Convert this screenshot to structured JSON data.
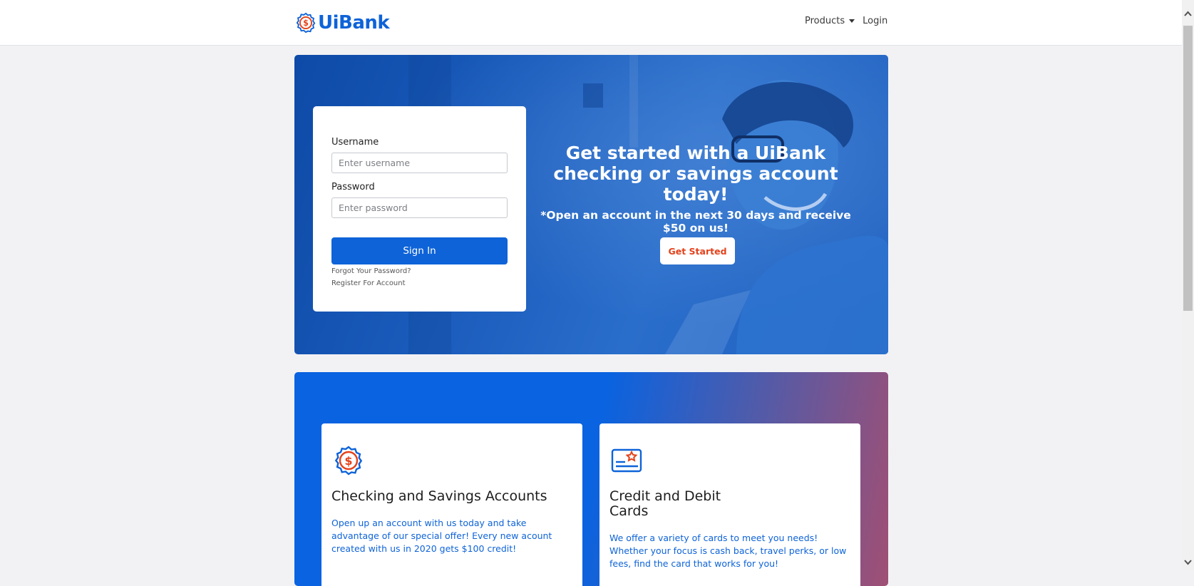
{
  "brand": {
    "name": "UiBank",
    "color": "#0e63d8"
  },
  "nav": {
    "products_label": "Products",
    "login_label": "Login"
  },
  "login": {
    "username_label": "Username",
    "username_placeholder": "Enter username",
    "password_label": "Password",
    "password_placeholder": "Enter password",
    "signin_label": "Sign In",
    "forgot_link": "Forgot Your Password?",
    "register_link": "Register For Account"
  },
  "hero": {
    "title": "Get started with a UiBank checking or savings account today!",
    "subtitle": "*Open an account in the next 30 days and receive $50 on us!",
    "cta_label": "Get Started",
    "cta_color": "#e4421b"
  },
  "products": {
    "cards": [
      {
        "icon": "dollar-badge-icon",
        "title": "Checking and Savings Accounts",
        "text": "Open up an account with us today and take advantage of our special offer! Every new acount created with us in 2020 gets $100 credit!"
      },
      {
        "icon": "credit-card-icon",
        "title": "Credit and Debit Cards",
        "text": "We offer a variety of cards to meet you needs! Whether your focus is cash back, travel perks, or low fees, find the card that works for you!"
      }
    ]
  }
}
